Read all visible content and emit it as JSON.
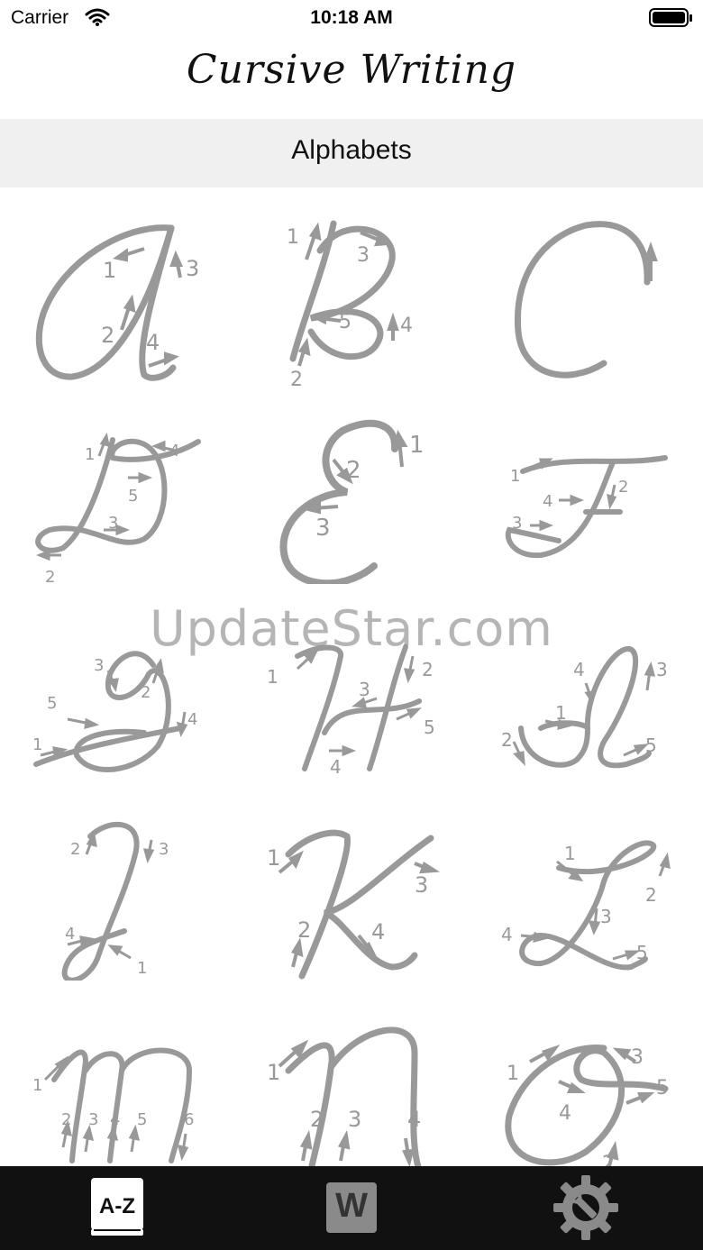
{
  "status_bar": {
    "carrier": "Carrier",
    "time": "10:18 AM"
  },
  "nav": {
    "title": "Cursive Writing"
  },
  "section": {
    "title": "Alphabets"
  },
  "watermark": "UpdateStar.com",
  "letters": [
    {
      "letter": "A",
      "steps": [
        "1",
        "2",
        "3",
        "4"
      ]
    },
    {
      "letter": "B",
      "steps": [
        "1",
        "2",
        "3",
        "4",
        "5"
      ]
    },
    {
      "letter": "C",
      "steps": []
    },
    {
      "letter": "D",
      "steps": [
        "1",
        "2",
        "3",
        "4",
        "5"
      ]
    },
    {
      "letter": "E",
      "steps": [
        "1",
        "2",
        "3"
      ]
    },
    {
      "letter": "F",
      "steps": [
        "1",
        "2",
        "3",
        "4"
      ]
    },
    {
      "letter": "G",
      "steps": [
        "1",
        "2",
        "3",
        "4",
        "5"
      ]
    },
    {
      "letter": "H",
      "steps": [
        "1",
        "2",
        "3",
        "4",
        "5"
      ]
    },
    {
      "letter": "I",
      "steps": [
        "1",
        "2",
        "3",
        "4",
        "5"
      ]
    },
    {
      "letter": "J",
      "steps": [
        "1",
        "2",
        "3",
        "4"
      ]
    },
    {
      "letter": "K",
      "steps": [
        "1",
        "2",
        "3",
        "4"
      ]
    },
    {
      "letter": "L",
      "steps": [
        "1",
        "2",
        "3",
        "4",
        "5"
      ]
    },
    {
      "letter": "M",
      "steps": [
        "1",
        "2",
        "3",
        "4",
        "5",
        "6"
      ]
    },
    {
      "letter": "N",
      "steps": [
        "1",
        "2",
        "3",
        "4"
      ]
    },
    {
      "letter": "O",
      "steps": [
        "1",
        "2",
        "3",
        "4",
        "5"
      ]
    }
  ],
  "tabs": [
    {
      "label": "A-Z",
      "icon": "alphabet-book-icon",
      "selected": true
    },
    {
      "label": "W",
      "icon": "words-icon",
      "selected": false
    },
    {
      "label": "",
      "icon": "settings-gear-wrench-icon",
      "selected": false
    }
  ],
  "colors": {
    "stroke": "#999999",
    "tab_bar": "#111111",
    "header_bg": "#f0f0f0"
  }
}
